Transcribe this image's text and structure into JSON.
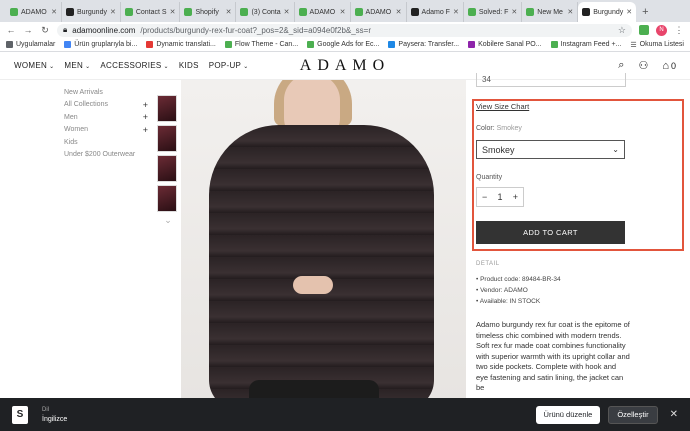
{
  "browser": {
    "tabs": [
      {
        "label": "ADAMO",
        "color": "#4caf50"
      },
      {
        "label": "Burgundy",
        "color": "#222222"
      },
      {
        "label": "Contact S",
        "color": "#4caf50"
      },
      {
        "label": "Shopify",
        "color": "#4caf50"
      },
      {
        "label": "(3) Conta",
        "color": "#4caf50"
      },
      {
        "label": "ADAMO",
        "color": "#4caf50"
      },
      {
        "label": "ADAMO",
        "color": "#4caf50"
      },
      {
        "label": "Adamo F",
        "color": "#222222"
      },
      {
        "label": "Solved: F",
        "color": "#4caf50"
      },
      {
        "label": "New Me",
        "color": "#4caf50"
      },
      {
        "label": "Burgundy",
        "color": "#222222"
      }
    ],
    "url_host": "adamoonline.com",
    "url_path": "/products/burgundy-rex-fur-coat?_pos=2&_sid=a094e0f2b&_ss=r",
    "profile_initial": "N",
    "bookmarks": [
      {
        "label": "Uygulamalar",
        "color": "#5f6368"
      },
      {
        "label": "Ürün gruplarıyla bi...",
        "color": "#4285f4"
      },
      {
        "label": "Dynamic translati...",
        "color": "#e53935"
      },
      {
        "label": "Flow Theme - Can...",
        "color": "#4caf50"
      },
      {
        "label": "Google Ads for Ec...",
        "color": "#4caf50"
      },
      {
        "label": "Paysera: Transfer...",
        "color": "#1e88e5"
      },
      {
        "label": "Kobilere Sanal PO...",
        "color": "#8e24aa"
      },
      {
        "label": "Instagram Feed +...",
        "color": "#4caf50"
      }
    ],
    "reading_list": "Okuma Listesi"
  },
  "store": {
    "menu": [
      "WOMEN",
      "MEN",
      "ACCESSORIES",
      "KIDS",
      "POP-UP"
    ],
    "logo": "ADAMO",
    "cart_count": "0",
    "categories": [
      {
        "label": "New Arrivals",
        "plus": ""
      },
      {
        "label": "All Collections",
        "plus": "+"
      },
      {
        "label": "Men",
        "plus": "+"
      },
      {
        "label": "Women",
        "plus": "+"
      },
      {
        "label": "Kids",
        "plus": ""
      },
      {
        "label": "Under $200 Outerwear",
        "plus": ""
      }
    ]
  },
  "product": {
    "size_value": "34",
    "view_size_chart": "View Size Chart",
    "color_label": "Color:",
    "color_value": "Smokey",
    "select_value": "Smokey",
    "quantity_label": "Quantity",
    "quantity": "1",
    "add_to_cart": "ADD TO CART",
    "detail_label": "DETAIL",
    "specs": [
      "Product code:  89484-BR-34",
      "Vendor: ADAMO",
      "Available: IN STOCK"
    ],
    "description": "Adamo burgundy rex fur coat is the epitome of timeless chic combined with modern trends. Soft rex fur made coat combines functionality with superior warmth with its upright collar and two side pockets. Complete with hook and eye fastening and satin lining, the jacket can be"
  },
  "shopify_bar": {
    "lang_small": "Dil",
    "lang_value": "İngilizce",
    "edit_button": "Ürünü düzenle",
    "customize_button": "Özelleştir"
  }
}
